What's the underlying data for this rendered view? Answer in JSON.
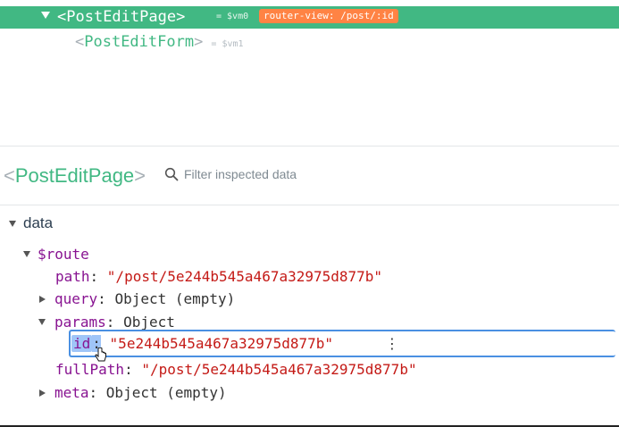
{
  "component_tree": {
    "selected": {
      "name": "PostEditPage",
      "vm": "= $vm0",
      "badge": "router-view: /post/:id"
    },
    "child": {
      "name": "PostEditForm",
      "vm": "= $vm1"
    }
  },
  "inspector": {
    "title": "PostEditPage",
    "filter_placeholder": "Filter inspected data"
  },
  "data_tree": {
    "section": "data",
    "route_key": "$route",
    "path_key": "path",
    "path_val": "\"/post/5e244b545a467a32975d877b\"",
    "query_key": "query",
    "query_val": "Object (empty)",
    "params_key": "params",
    "params_val": "Object",
    "id_key": "id",
    "id_val": "\"5e244b545a467a32975d877b\"",
    "fullpath_key": "fullPath",
    "fullpath_val": "\"/post/5e244b545a467a32975d877b\"",
    "meta_key": "meta",
    "meta_val": "Object (empty)"
  },
  "colors": {
    "accent": "#41b883",
    "badge": "#ff8344",
    "key": "#881391",
    "string": "#c41a16",
    "selection": "#4a90e2"
  }
}
